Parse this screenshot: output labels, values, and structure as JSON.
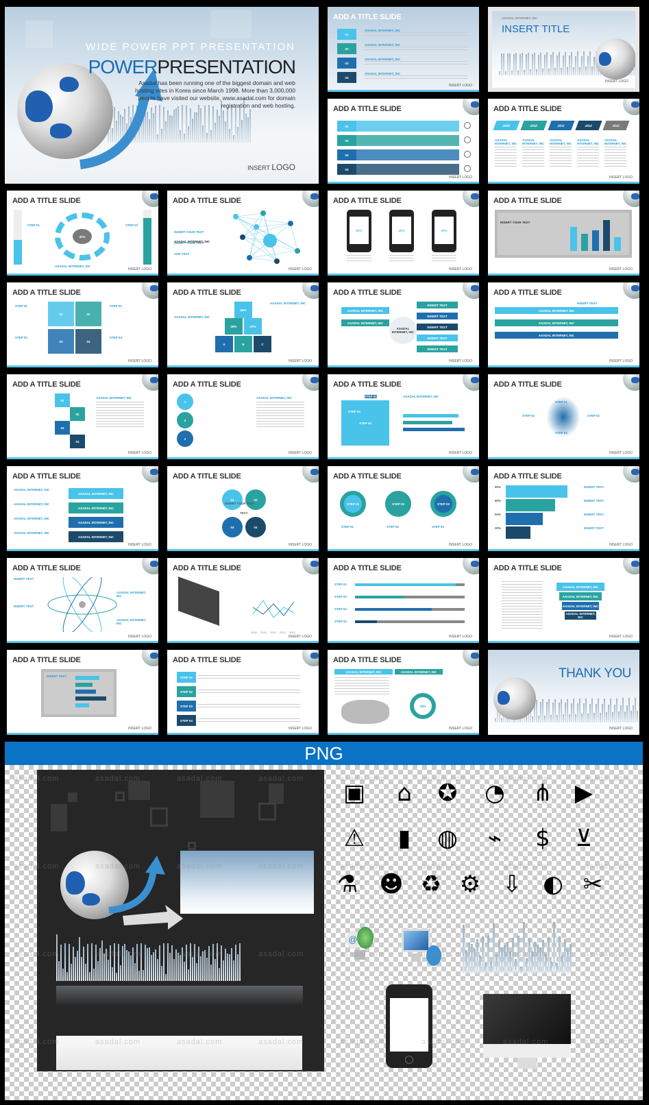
{
  "hero": {
    "subtitle": "WIDE POWER PPT PRESENTATION",
    "title_accent": "POWER",
    "title_rest": "PRESENTATION",
    "description": "Asadal has been running one of the biggest domain and web hosting sites in Korea since March 1998. More than 3,000,000 people have visited our website, www.asadal.com for domain registration and web hosting.",
    "logo_prefix": "INSERT",
    "logo_word": "LOGO"
  },
  "colors": {
    "sky": "#49c3ea",
    "teal": "#2aa3a0",
    "blue": "#1f6fae",
    "navy": "#1b4a6b",
    "gray": "#7a7a7a",
    "banner": "#0a73c5"
  },
  "logo_text": "INSERT LOGO",
  "slides": [
    {
      "title": "ADD A TITLE SLIDE",
      "kind": "numbered",
      "labels": [
        "01",
        "02",
        "03",
        "04"
      ],
      "sub": "ADD TEXT",
      "head": "ASADAL INTERNET, INC",
      "dark": true
    },
    {
      "title": "INSERT TITLE",
      "kind": "insert",
      "labels": [],
      "head": "ASADAL INTERNET, INC"
    },
    {
      "title": "ADD A TITLE SLIDE",
      "kind": "ribbon",
      "labels": [
        "01",
        "02",
        "03",
        "04"
      ]
    },
    {
      "title": "ADD A TITLE SLIDE",
      "kind": "timeline",
      "labels": [
        "2009",
        "2010",
        "2011",
        "2012",
        "2013"
      ],
      "head": "ASADAL INTERNET, INC"
    },
    {
      "title": "ADD A TITLE SLIDE",
      "kind": "gauge",
      "labels": [
        "STEP 01",
        "40%",
        "STEP 02"
      ],
      "head": "ASADAL INTERNET, INC"
    },
    {
      "title": "ADD A TITLE SLIDE",
      "kind": "network",
      "labels": [
        "INSERT YOUR TEXT",
        "INSERT YOUR TEXT",
        "ADD TEXT"
      ],
      "head": "ASADAL INTERNET, INC"
    },
    {
      "title": "ADD A TITLE SLIDE",
      "kind": "phones",
      "labels": [
        "60%",
        "40%",
        "40%"
      ]
    },
    {
      "title": "ADD A TITLE SLIDE",
      "kind": "tabs",
      "labels": [
        "ASADAL INTERNET, INC",
        "INSERT YOUR TEXT"
      ]
    },
    {
      "title": "ADD A TITLE SLIDE",
      "kind": "cube",
      "labels": [
        "01",
        "02",
        "03",
        "04"
      ],
      "steps": [
        "STEP 01",
        "STEP 02",
        "STEP 03",
        "STEP 04"
      ]
    },
    {
      "title": "ADD A TITLE SLIDE",
      "kind": "blocks",
      "labels": [
        "A",
        "B",
        "C",
        "28%",
        "37%",
        "55%"
      ],
      "head": "ASADAL INTERNET, INC"
    },
    {
      "title": "ADD A TITLE SLIDE",
      "kind": "cross",
      "labels": [
        "ASADAL INTERNET, INC",
        "INSERT TEXT"
      ],
      "center": "ASADAL INTERNET, INC"
    },
    {
      "title": "ADD A TITLE SLIDE",
      "kind": "arrow",
      "labels": [
        "ASADAL INTERNET, INC",
        "ASADAL INTERNET, INC",
        "ASADAL INTERNET, INC"
      ],
      "head": "INSERT TEXT"
    },
    {
      "title": "ADD A TITLE SLIDE",
      "kind": "hex",
      "labels": [
        "01",
        "02",
        "03",
        "04"
      ],
      "head": "ASADAL INTERNET, INC"
    },
    {
      "title": "ADD A TITLE SLIDE",
      "kind": "circles",
      "labels": [
        "1",
        "2",
        "3"
      ],
      "head": "ASADAL INTERNET, INC"
    },
    {
      "title": "ADD A TITLE SLIDE",
      "kind": "folders",
      "labels": [
        "STEP 01",
        "STEP 02",
        "STEP 03"
      ],
      "head": "ASADAL INTERNET, INC"
    },
    {
      "title": "ADD A TITLE SLIDE",
      "kind": "xcross",
      "labels": [
        "STEP 01",
        "STEP 02",
        "STEP 03",
        "STEP 04"
      ]
    },
    {
      "title": "ADD A TITLE SLIDE",
      "kind": "layers",
      "labels": [
        "ASADAL INTERNET, INC",
        "ASADAL INTERNET, INC",
        "ASADAL INTERNET, INC",
        "ASADAL INTERNET, INC"
      ]
    },
    {
      "title": "ADD A TITLE SLIDE",
      "kind": "quad",
      "labels": [
        "01",
        "02",
        "03",
        "04"
      ],
      "center": "TEXT",
      "sub": "INSERT YOUR TEXT"
    },
    {
      "title": "ADD A TITLE SLIDE",
      "kind": "donuts",
      "labels": [
        "STEP 01",
        "STEP 02",
        "STEP 03"
      ]
    },
    {
      "title": "ADD A TITLE SLIDE",
      "kind": "funnel",
      "labels": [
        "90%",
        "80%",
        "50%",
        "30%"
      ],
      "head": "INSERT TEXT"
    },
    {
      "title": "ADD A TITLE SLIDE",
      "kind": "atom",
      "labels": [
        "INSERT TEXT",
        "ASADAL INTERNET, INC",
        "INSERT TEXT",
        "ASADAL INTERNET, INC"
      ]
    },
    {
      "title": "ADD A TITLE SLIDE",
      "kind": "tablet",
      "labels": [
        "2009",
        "2010",
        "2011",
        "2012",
        "2013"
      ]
    },
    {
      "title": "ADD A TITLE SLIDE",
      "kind": "sliders",
      "labels": [
        "STEP 01",
        "STEP 02",
        "STEP 03",
        "STEP 04"
      ],
      "values": [
        0.92,
        0.45,
        0.7,
        0.2
      ]
    },
    {
      "title": "ADD A TITLE SLIDE",
      "kind": "cart",
      "labels": [
        "ASADAL INTERNET, INC",
        "ASADAL INTERNET, INC",
        "ASADAL INTERNET, INC",
        "ASADAL INTERNET, INC"
      ]
    },
    {
      "title": "ADD A TITLE SLIDE",
      "kind": "monitor",
      "labels": [
        "ASADAL INTERNET, INC",
        "ASADAL INTERNET, INC",
        "ASADAL INTERNET, INC",
        "ASADAL INTERNET, INC"
      ],
      "head": "INSERT TEXT"
    },
    {
      "title": "ADD A TITLE SLIDE",
      "kind": "stepsbar",
      "labels": [
        "STEP 01",
        "STEP 02",
        "STEP 03",
        "STEP 04"
      ]
    },
    {
      "title": "ADD A TITLE SLIDE",
      "kind": "map",
      "labels": [
        "ASADAL INTERNET, INC",
        "ASADAL INTERNET, INC",
        "75%"
      ]
    },
    {
      "title": "THANK YOU",
      "kind": "thanks",
      "labels": []
    }
  ],
  "png_section": {
    "banner": "PNG",
    "watermark": "asadal.com",
    "icons": [
      [
        "tv-icon",
        "home-icon",
        "award-icon",
        "rss-icon",
        "share-icon",
        "video-icon"
      ],
      [
        "warning-icon",
        "battery-icon",
        "globe-icon",
        "satellite-icon",
        "money-bag-icon",
        "cart-icon"
      ],
      [
        "flask-add-icon",
        "user-add-icon",
        "recycle-bin-icon",
        "gears-icon",
        "download-icon",
        "mouse-icon",
        "tools-icon"
      ]
    ]
  }
}
